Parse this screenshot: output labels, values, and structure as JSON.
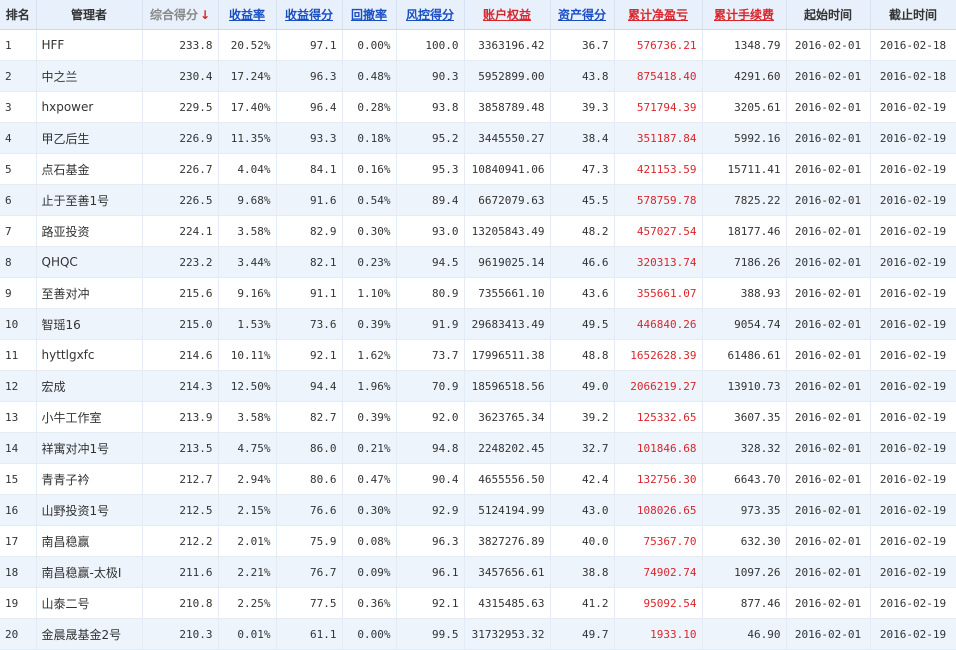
{
  "headers": [
    "排名",
    "管理者",
    "综合得分",
    "收益率",
    "收益得分",
    "回撤率",
    "风控得分",
    "账户权益",
    "资产得分",
    "累计净盈亏",
    "累计手续费",
    "起始时间",
    "截止时间"
  ],
  "sort_arrow": "↓",
  "rows": [
    [
      "1",
      "HFF",
      "233.8",
      "20.52%",
      "97.1",
      "0.00%",
      "100.0",
      "3363196.42",
      "36.7",
      "576736.21",
      "1348.79",
      "2016-02-01",
      "2016-02-18"
    ],
    [
      "2",
      "中之兰",
      "230.4",
      "17.24%",
      "96.3",
      "0.48%",
      "90.3",
      "5952899.00",
      "43.8",
      "875418.40",
      "4291.60",
      "2016-02-01",
      "2016-02-18"
    ],
    [
      "3",
      "hxpower",
      "229.5",
      "17.40%",
      "96.4",
      "0.28%",
      "93.8",
      "3858789.48",
      "39.3",
      "571794.39",
      "3205.61",
      "2016-02-01",
      "2016-02-19"
    ],
    [
      "4",
      "甲乙后生",
      "226.9",
      "11.35%",
      "93.3",
      "0.18%",
      "95.2",
      "3445550.27",
      "38.4",
      "351187.84",
      "5992.16",
      "2016-02-01",
      "2016-02-19"
    ],
    [
      "5",
      "点石基金",
      "226.7",
      "4.04%",
      "84.1",
      "0.16%",
      "95.3",
      "10840941.06",
      "47.3",
      "421153.59",
      "15711.41",
      "2016-02-01",
      "2016-02-19"
    ],
    [
      "6",
      "止于至善1号",
      "226.5",
      "9.68%",
      "91.6",
      "0.54%",
      "89.4",
      "6672079.63",
      "45.5",
      "578759.78",
      "7825.22",
      "2016-02-01",
      "2016-02-19"
    ],
    [
      "7",
      "路亚投资",
      "224.1",
      "3.58%",
      "82.9",
      "0.30%",
      "93.0",
      "13205843.49",
      "48.2",
      "457027.54",
      "18177.46",
      "2016-02-01",
      "2016-02-19"
    ],
    [
      "8",
      "QHQC",
      "223.2",
      "3.44%",
      "82.1",
      "0.23%",
      "94.5",
      "9619025.14",
      "46.6",
      "320313.74",
      "7186.26",
      "2016-02-01",
      "2016-02-19"
    ],
    [
      "9",
      "至善对冲",
      "215.6",
      "9.16%",
      "91.1",
      "1.10%",
      "80.9",
      "7355661.10",
      "43.6",
      "355661.07",
      "388.93",
      "2016-02-01",
      "2016-02-19"
    ],
    [
      "10",
      "智瑶16",
      "215.0",
      "1.53%",
      "73.6",
      "0.39%",
      "91.9",
      "29683413.49",
      "49.5",
      "446840.26",
      "9054.74",
      "2016-02-01",
      "2016-02-19"
    ],
    [
      "11",
      "hyttlgxfc",
      "214.6",
      "10.11%",
      "92.1",
      "1.62%",
      "73.7",
      "17996511.38",
      "48.8",
      "1652628.39",
      "61486.61",
      "2016-02-01",
      "2016-02-19"
    ],
    [
      "12",
      "宏成",
      "214.3",
      "12.50%",
      "94.4",
      "1.96%",
      "70.9",
      "18596518.56",
      "49.0",
      "2066219.27",
      "13910.73",
      "2016-02-01",
      "2016-02-19"
    ],
    [
      "13",
      "小牛工作室",
      "213.9",
      "3.58%",
      "82.7",
      "0.39%",
      "92.0",
      "3623765.34",
      "39.2",
      "125332.65",
      "3607.35",
      "2016-02-01",
      "2016-02-19"
    ],
    [
      "14",
      "祥寓对冲1号",
      "213.5",
      "4.75%",
      "86.0",
      "0.21%",
      "94.8",
      "2248202.45",
      "32.7",
      "101846.68",
      "328.32",
      "2016-02-01",
      "2016-02-19"
    ],
    [
      "15",
      "青青子衿",
      "212.7",
      "2.94%",
      "80.6",
      "0.47%",
      "90.4",
      "4655556.50",
      "42.4",
      "132756.30",
      "6643.70",
      "2016-02-01",
      "2016-02-19"
    ],
    [
      "16",
      "山野投资1号",
      "212.5",
      "2.15%",
      "76.6",
      "0.30%",
      "92.9",
      "5124194.99",
      "43.0",
      "108026.65",
      "973.35",
      "2016-02-01",
      "2016-02-19"
    ],
    [
      "17",
      "南昌稳赢",
      "212.2",
      "2.01%",
      "75.9",
      "0.08%",
      "96.3",
      "3827276.89",
      "40.0",
      "75367.70",
      "632.30",
      "2016-02-01",
      "2016-02-19"
    ],
    [
      "18",
      "南昌稳赢-太极I",
      "211.6",
      "2.21%",
      "76.7",
      "0.09%",
      "96.1",
      "3457656.61",
      "38.8",
      "74902.74",
      "1097.26",
      "2016-02-01",
      "2016-02-19"
    ],
    [
      "19",
      "山泰二号",
      "210.8",
      "2.25%",
      "77.5",
      "0.36%",
      "92.1",
      "4315485.63",
      "41.2",
      "95092.54",
      "877.46",
      "2016-02-01",
      "2016-02-19"
    ],
    [
      "20",
      "金晨晟基金2号",
      "210.3",
      "0.01%",
      "61.1",
      "0.00%",
      "99.5",
      "31732953.32",
      "49.7",
      "1933.10",
      "46.90",
      "2016-02-01",
      "2016-02-19"
    ]
  ]
}
